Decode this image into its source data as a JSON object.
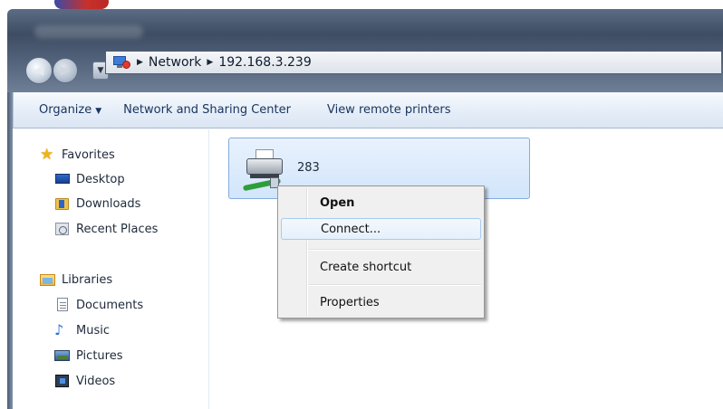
{
  "address_bar": {
    "crumbs": [
      "Network",
      "192.168.3.239"
    ]
  },
  "toolbar": {
    "organize": "Organize",
    "network_sharing": "Network and Sharing Center",
    "view_printers": "View remote printers"
  },
  "nav": {
    "favorites": {
      "label": "Favorites",
      "items": [
        "Desktop",
        "Downloads",
        "Recent Places"
      ]
    },
    "libraries": {
      "label": "Libraries",
      "items": [
        "Documents",
        "Music",
        "Pictures",
        "Videos"
      ]
    }
  },
  "content": {
    "printer_name": "283"
  },
  "context_menu": {
    "items": [
      "Open",
      "Connect...",
      "Create shortcut",
      "Properties"
    ]
  },
  "icons": {
    "favorites": "star-icon",
    "desktop": "desktop-icon",
    "downloads": "downloads-folder-icon",
    "recent": "recent-places-icon",
    "libraries": "libraries-icon",
    "documents": "documents-icon",
    "music": "music-note-icon",
    "pictures": "pictures-icon",
    "videos": "videos-icon",
    "printer": "network-printer-icon",
    "network": "network-icon"
  },
  "colors": {
    "selection_fill": "#d2e5fb",
    "selection_border": "#84acdd",
    "menu_hover_border": "#a8cbef",
    "toolbar_text": "#1a3560"
  }
}
